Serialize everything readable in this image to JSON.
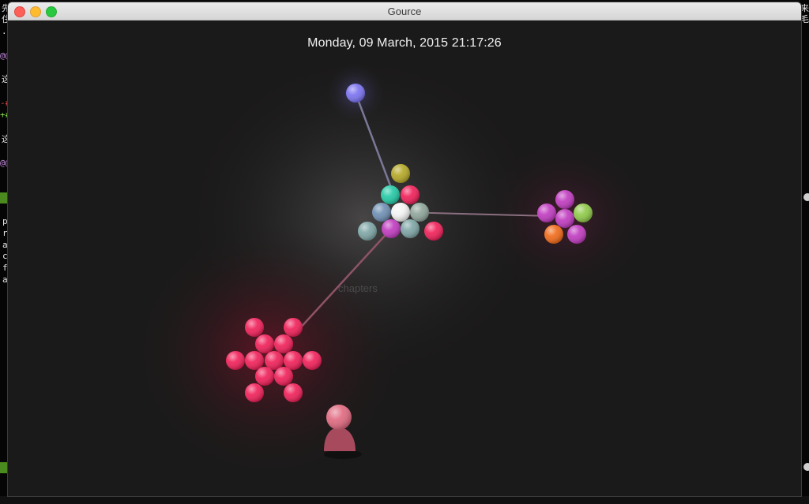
{
  "window": {
    "title": "Gource"
  },
  "visualization": {
    "date": "Monday, 09 March, 2015 21:17:26",
    "directory_label": "chapters"
  },
  "background_terminal": {
    "left_fragments": [
      "先",
      "住",
      "·",
      "@@",
      "这",
      "-#",
      "+#",
      "这",
      "@@",
      "p",
      "r",
      "a",
      "c",
      "f",
      "a"
    ],
    "right_fragments": [
      "来",
      "毛"
    ]
  },
  "colors": {
    "background": "#1b1a1a",
    "user_node": "#7b73f0",
    "pink": "#f0215a",
    "magenta": "#c03cc0",
    "teal": "#25c9a6",
    "olive": "#b5a828",
    "gray_blue": "#6f8fb3",
    "gray_green": "#8fa59b",
    "avatar": "#e06a80",
    "lime": "#8fc94a",
    "orange": "#f06b1a"
  }
}
